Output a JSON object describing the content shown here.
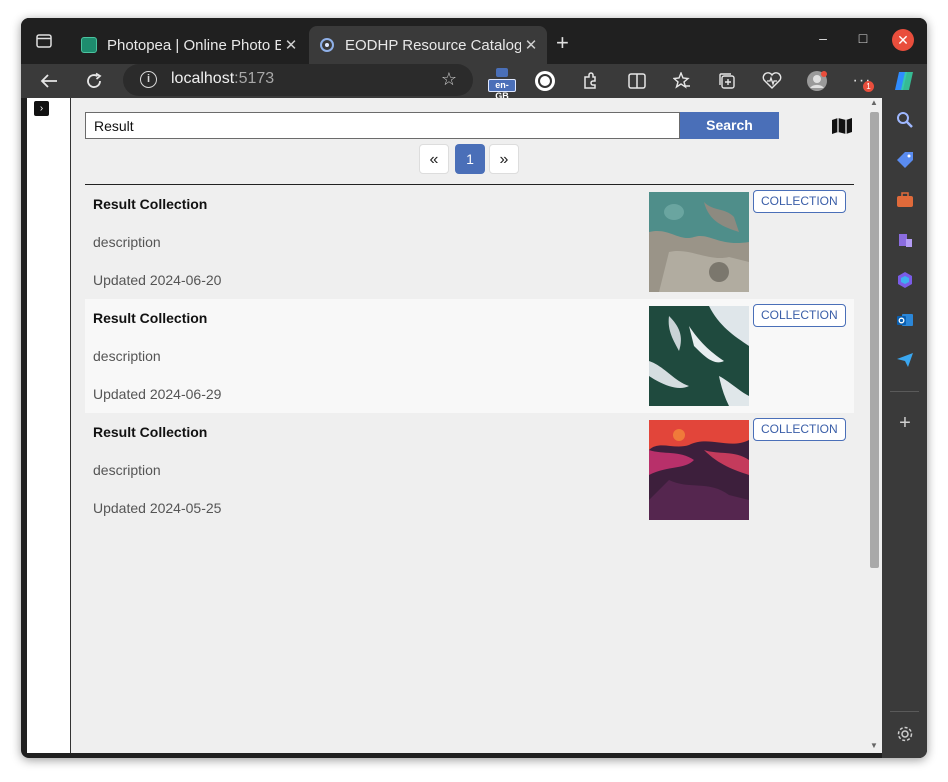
{
  "browser": {
    "tabs": [
      {
        "title": "Photopea | Online Photo Editor",
        "active": false
      },
      {
        "title": "EODHP Resource Catalogue",
        "active": true
      }
    ],
    "new_tab": "+",
    "minimize": "–",
    "maximize": "□",
    "close": "✕",
    "tab_close": "✕",
    "address": {
      "host": "localhost",
      "port": ":5173"
    },
    "translate_badge": "en-GB"
  },
  "app": {
    "search": {
      "value": "Result",
      "button_label": "Search"
    },
    "pagination": {
      "prev": "«",
      "current": "1",
      "next": "»"
    },
    "results": [
      {
        "title": "Result Collection",
        "description": "description",
        "updated": "Updated 2024-06-20",
        "badge": "COLLECTION"
      },
      {
        "title": "Result Collection",
        "description": "description",
        "updated": "Updated 2024-06-29",
        "badge": "COLLECTION"
      },
      {
        "title": "Result Collection",
        "description": "description",
        "updated": "Updated 2024-05-25",
        "badge": "COLLECTION"
      }
    ]
  },
  "colors": {
    "accent": "#4a6fb8",
    "tab_bg": "#202020",
    "toolbar_bg": "#3a3a3a",
    "close_red": "#e94e3c"
  }
}
